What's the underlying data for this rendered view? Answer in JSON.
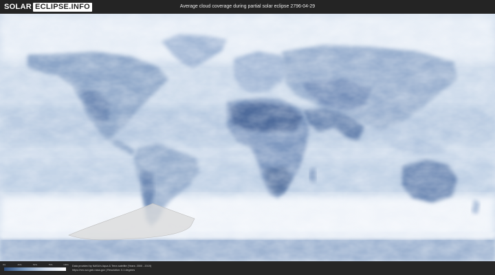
{
  "logo": {
    "part1": "SOLAR",
    "part2": "ECLIPSE.INFO"
  },
  "title": "Average cloud coverage during partial solar eclipse 2796-04-29",
  "legend": {
    "ticks": [
      "0%",
      "25%",
      "50%",
      "75%",
      "100%"
    ],
    "low_color": "#2f4f7e",
    "high_color": "#ffffff"
  },
  "credits": {
    "line1": "Data provided by NASA's Aqua & Terra satellite (Years: 2000 - 2019)",
    "line2": "https://neo.sci.gsfc.nasa.gov | Resolution: 0.1 degrees"
  },
  "colors": {
    "ocean_cloud": "#d6e1ee",
    "land": "#8aa3c6",
    "dry_land": "#5f7aa5",
    "eclipse_zone": "#d9d9d9"
  }
}
